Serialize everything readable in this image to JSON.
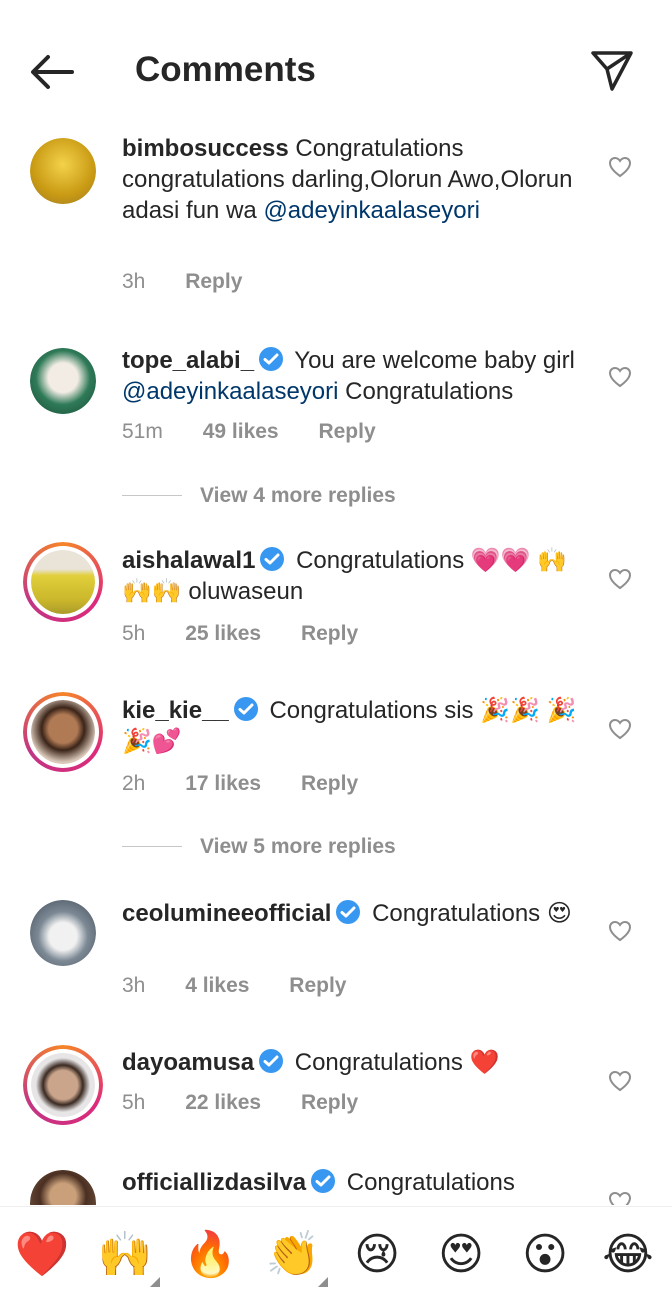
{
  "header": {
    "title": "Comments"
  },
  "comments": [
    {
      "username": "bimbosuccess",
      "verified": false,
      "text": "Congratulations congratulations darling,Olorun Awo,Olorun adasi fun wa",
      "mention": "@adeyinkaalaseyori",
      "text_after": "",
      "time": "3h",
      "likes": "",
      "reply": "Reply",
      "avatar_color": "#d9b21a"
    },
    {
      "username": "tope_alabi_",
      "verified": true,
      "text": "You are welcome baby girl",
      "mention": "@adeyinkaalaseyori",
      "text_after": "Congratulations",
      "time": "51m",
      "likes": "49 likes",
      "reply": "Reply",
      "avatar_color": "#1f6b4a",
      "view_more": "View 4 more replies"
    },
    {
      "username": "aishalawal1",
      "verified": true,
      "text": "Congratulations 💗💗 🙌🙌🙌 oluwaseun",
      "time": "5h",
      "likes": "25 likes",
      "reply": "Reply",
      "avatar_color": "#e8d13a"
    },
    {
      "username": "kie_kie__",
      "verified": true,
      "text": "Congratulations sis 🎉🎉 🎉🎉💕",
      "time": "2h",
      "likes": "17 likes",
      "reply": "Reply",
      "avatar_color": "#8a5a3c",
      "view_more": "View 5 more replies"
    },
    {
      "username": "ceolumineeofficial",
      "verified": true,
      "text": "Congratulations 😍",
      "time": "3h",
      "likes": "4 likes",
      "reply": "Reply",
      "avatar_color": "#5d6b7a"
    },
    {
      "username": "dayoamusa",
      "verified": true,
      "text": "Congratulations ❤️",
      "time": "5h",
      "likes": "22 likes",
      "reply": "Reply",
      "avatar_color": "#b08a74"
    },
    {
      "username": "officiallizdasilva",
      "verified": true,
      "text": "Congratulations",
      "avatar_color": "#6b4a3a"
    }
  ],
  "emoji_bar": [
    "❤️",
    "🙌",
    "🔥",
    "👏",
    "😢",
    "😍",
    "😮",
    "😂"
  ],
  "colors": {
    "accent_verified": "#3897f0",
    "mention": "#00376b",
    "muted": "#8e8e8e"
  }
}
